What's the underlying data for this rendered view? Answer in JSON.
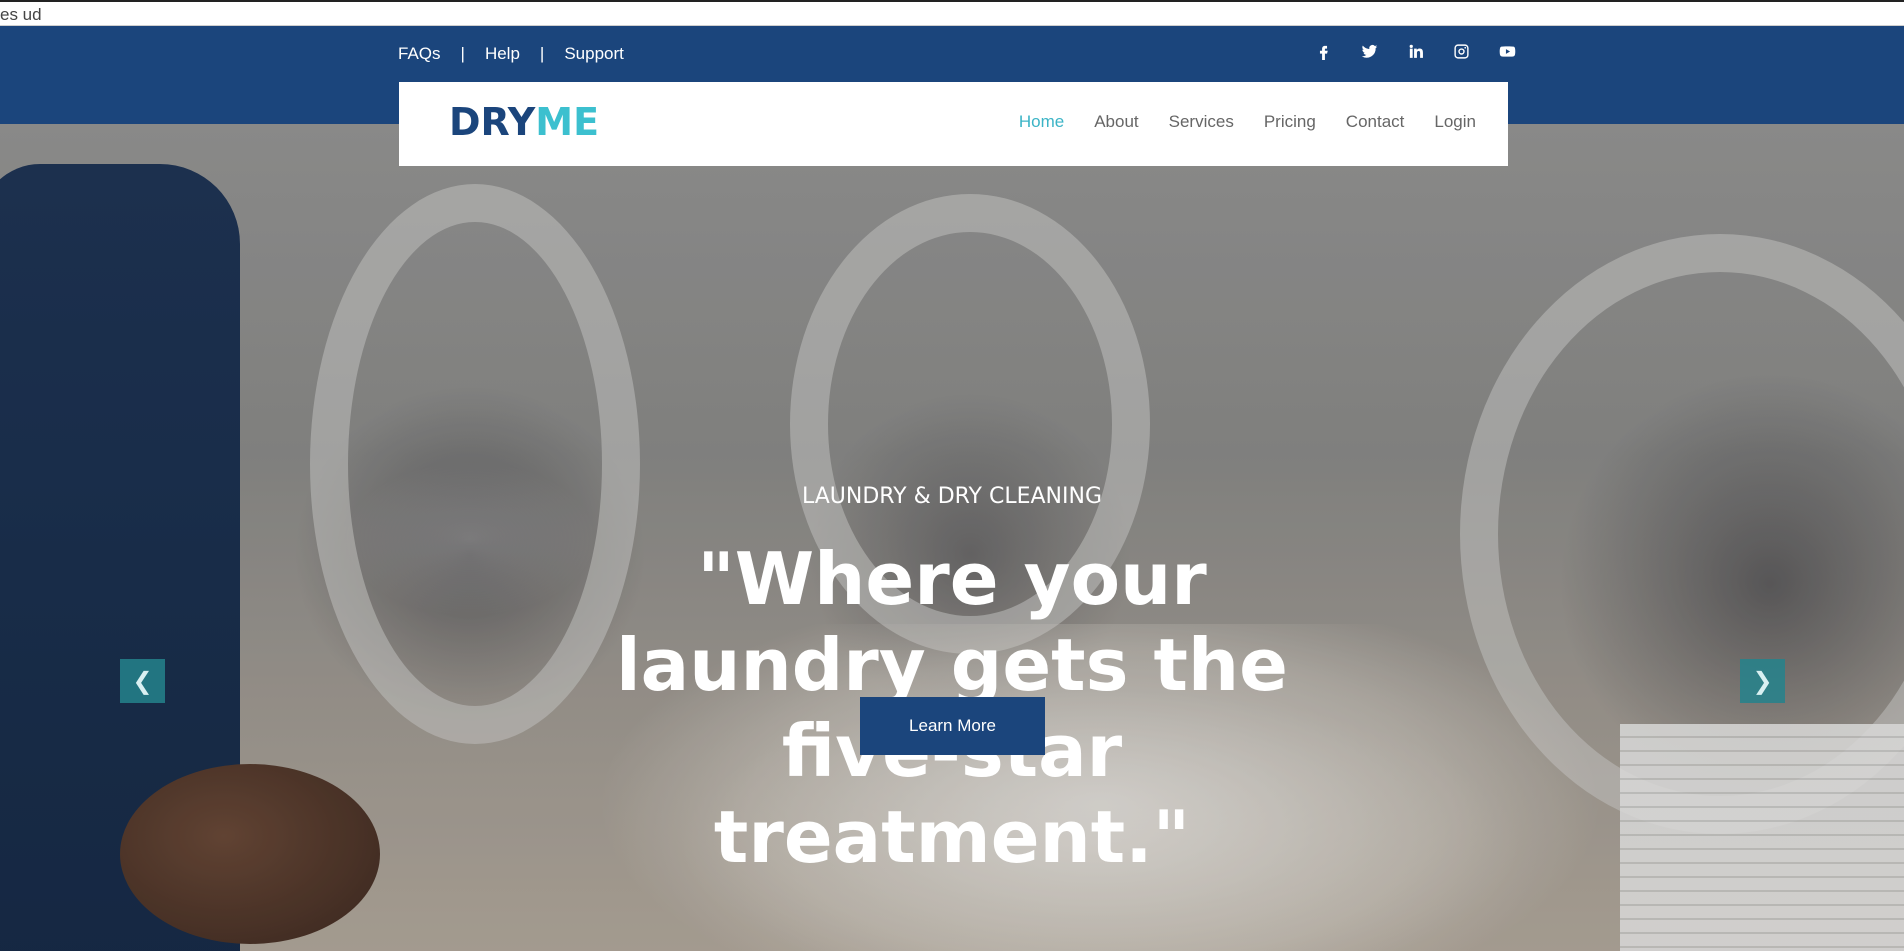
{
  "stray_text": "es ud",
  "topbar": {
    "links": [
      "FAQs",
      "Help",
      "Support"
    ],
    "separator": "|",
    "socials": [
      "facebook-icon",
      "twitter-icon",
      "linkedin-icon",
      "instagram-icon",
      "youtube-icon"
    ]
  },
  "brand": {
    "part1": "DRY",
    "part2": "ME",
    "color1": "#1b457c",
    "color2": "#3cc0cf"
  },
  "nav": {
    "items": [
      "Home",
      "About",
      "Services",
      "Pricing",
      "Contact",
      "Login"
    ],
    "active": "Home",
    "active_color": "#3cb4c6"
  },
  "hero": {
    "kicker": "LAUNDRY & DRY CLEANING",
    "headline": "\"Where your laundry gets the five-star treatment.\"",
    "cta": "Learn More",
    "prev_icon": "chevron-left-icon",
    "next_icon": "chevron-right-icon"
  },
  "colors": {
    "primary": "#1b457c",
    "accent": "#3cc0cf",
    "arrow": "#24828c"
  }
}
